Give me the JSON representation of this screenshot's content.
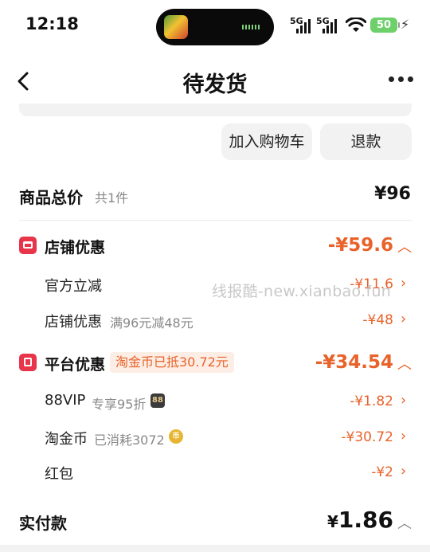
{
  "status_bar": {
    "time": "12:18",
    "signal_1": "5G",
    "signal_2": "5G",
    "battery": "50",
    "island_icon": "music-app-thumbnail-icon"
  },
  "nav": {
    "title": "待发货",
    "back_icon": "chevron-left-icon",
    "more_icon": "more-dots-icon"
  },
  "actions": {
    "add_to_cart": "加入购物车",
    "refund": "退款"
  },
  "total": {
    "label": "商品总价",
    "count": "共1件",
    "amount": "¥96"
  },
  "shop_discount": {
    "label": "店铺优惠",
    "amount": "-¥59.6",
    "items": [
      {
        "label": "官方立减",
        "note": "",
        "amount": "-¥11.6"
      },
      {
        "label": "店铺优惠",
        "note": "满96元减48元",
        "amount": "-¥48"
      }
    ]
  },
  "platform_discount": {
    "label": "平台优惠",
    "tag": "淘金币已抵30.72元",
    "amount": "-¥34.54",
    "items": [
      {
        "label": "88VIP",
        "note": "专享95折",
        "badge": "88",
        "amount": "-¥1.82"
      },
      {
        "label": "淘金币",
        "note": "已消耗3072",
        "badge": "币",
        "amount": "-¥30.72"
      },
      {
        "label": "红包",
        "note": "",
        "amount": "-¥2"
      }
    ]
  },
  "paid": {
    "label": "实付款",
    "currency": "¥",
    "amount": "1.86"
  },
  "watermark": "线报酷-new.xianbao.fun",
  "colors": {
    "accent": "#e8622a",
    "red_icon": "#e8354a",
    "button_bg": "#f2f2f3"
  }
}
